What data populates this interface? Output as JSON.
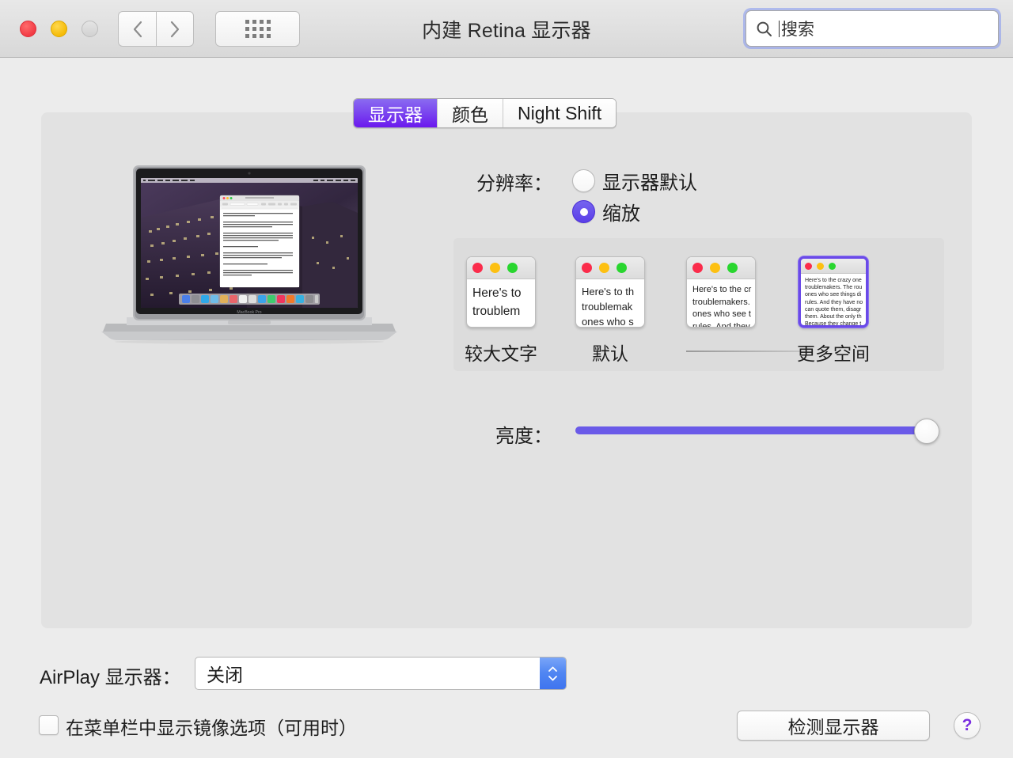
{
  "window": {
    "title": "内建 Retina 显示器",
    "traffic": {
      "close": "close-button",
      "minimize": "minimize-button",
      "zoom": "zoom-button"
    },
    "nav": {
      "back": "‹",
      "forward": "›"
    },
    "show_all": "show-all-grid"
  },
  "search": {
    "placeholder": "搜索",
    "icon": "search-icon"
  },
  "tabs": [
    {
      "label": "显示器",
      "active": true
    },
    {
      "label": "颜色",
      "active": false
    },
    {
      "label": "Night Shift",
      "active": false
    }
  ],
  "resolution": {
    "label": "分辨率：",
    "options": [
      {
        "label": "显示器默认",
        "selected": false
      },
      {
        "label": "缩放",
        "selected": true
      }
    ]
  },
  "scaling": {
    "items": [
      {
        "label": "较大文字",
        "selected": false,
        "preview": "Here's to\ntroublem"
      },
      {
        "label": "默认",
        "selected": false,
        "preview": "Here's to th\ntroublemak\nones who s"
      },
      {
        "label": "更多空间",
        "selected": false,
        "preview": "Here's to the cr\ntroublemakers.\nones who see t\nrules. And they"
      },
      {
        "label": "更多空间",
        "selected": true,
        "preview": "Here's to the crazy one\ntroublemakers. The rou\nones who see things di\nrules. And they have no\ncan quote them, disagr\nthem. About the only th\nBecause they change t"
      }
    ],
    "third_label_hidden": true
  },
  "brightness": {
    "label": "亮度：",
    "value": 100
  },
  "display_illustration": {
    "model_label": "MacBook Pro",
    "document_text": "Here's to the crazy ones. The misfits. The rebels. The troublemakers. The round pegs in the square holes."
  },
  "airplay": {
    "label": "AirPlay 显示器：",
    "value": "关闭"
  },
  "mirror_option": {
    "label": "在菜单栏中显示镜像选项（可用时）",
    "checked": false
  },
  "buttons": {
    "detect": "检测显示器",
    "help": "?"
  },
  "colors": {
    "accent_purple": "#6a4ae8",
    "tab_active": "#7a44ef",
    "slider_fill": "#6a5ae8",
    "stepper_blue": "#4f85f2",
    "help_glyph": "#7b2fe0"
  }
}
